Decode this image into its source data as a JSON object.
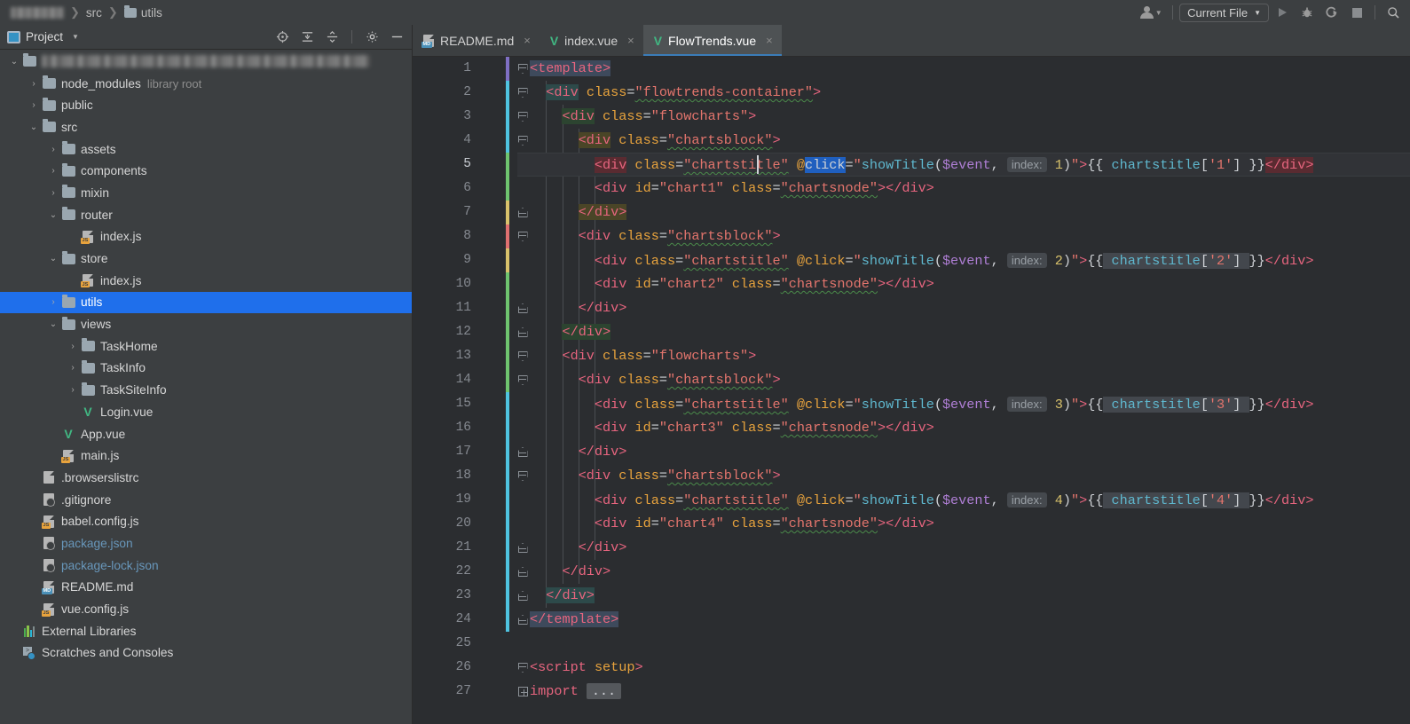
{
  "window": {
    "breadcrumb": [
      {
        "label": "",
        "blurred": true,
        "icon": ""
      },
      {
        "label": "src",
        "blurred": false,
        "icon": ""
      },
      {
        "label": "utils",
        "blurred": false,
        "icon": "folder-icon"
      }
    ],
    "run_config_label": "Current File",
    "toolbar_icons": [
      "person-icon",
      "run-icon",
      "debug-icon",
      "run-coverage-icon",
      "stop-icon",
      "search-icon"
    ]
  },
  "sidebar": {
    "title": "Project",
    "header_icons": [
      "locate-icon",
      "expand-all-icon",
      "collapse-all-icon",
      "gear-icon",
      "hide-icon"
    ],
    "tree": [
      {
        "depth": 0,
        "label": "",
        "blurred": true,
        "arrow": "down",
        "icon": "folder-icon",
        "sub": "",
        "selected": false
      },
      {
        "depth": 1,
        "label": "node_modules",
        "arrow": "right",
        "icon": "folder-icon",
        "sub": "library root",
        "selected": false
      },
      {
        "depth": 1,
        "label": "public",
        "arrow": "right",
        "icon": "folder-icon",
        "sub": "",
        "selected": false
      },
      {
        "depth": 1,
        "label": "src",
        "arrow": "down",
        "icon": "folder-icon",
        "sub": "",
        "selected": false
      },
      {
        "depth": 2,
        "label": "assets",
        "arrow": "right",
        "icon": "folder-icon",
        "sub": "",
        "selected": false
      },
      {
        "depth": 2,
        "label": "components",
        "arrow": "right",
        "icon": "folder-icon",
        "sub": "",
        "selected": false
      },
      {
        "depth": 2,
        "label": "mixin",
        "arrow": "right",
        "icon": "folder-icon",
        "sub": "",
        "selected": false
      },
      {
        "depth": 2,
        "label": "router",
        "arrow": "down",
        "icon": "folder-icon",
        "sub": "",
        "selected": false
      },
      {
        "depth": 3,
        "label": "index.js",
        "arrow": "none",
        "icon": "js-file-icon",
        "sub": "",
        "selected": false
      },
      {
        "depth": 2,
        "label": "store",
        "arrow": "down",
        "icon": "folder-icon",
        "sub": "",
        "selected": false
      },
      {
        "depth": 3,
        "label": "index.js",
        "arrow": "none",
        "icon": "js-file-icon",
        "sub": "",
        "selected": false
      },
      {
        "depth": 2,
        "label": "utils",
        "arrow": "right",
        "icon": "folder-icon",
        "sub": "",
        "selected": true
      },
      {
        "depth": 2,
        "label": "views",
        "arrow": "down",
        "icon": "folder-icon",
        "sub": "",
        "selected": false
      },
      {
        "depth": 3,
        "label": "TaskHome",
        "arrow": "right",
        "icon": "folder-icon",
        "sub": "",
        "selected": false
      },
      {
        "depth": 3,
        "label": "TaskInfo",
        "arrow": "right",
        "icon": "folder-icon",
        "sub": "",
        "selected": false
      },
      {
        "depth": 3,
        "label": "TaskSiteInfo",
        "arrow": "right",
        "icon": "folder-icon",
        "sub": "",
        "selected": false
      },
      {
        "depth": 3,
        "label": "Login.vue",
        "arrow": "none",
        "icon": "vue-file-icon",
        "sub": "",
        "selected": false
      },
      {
        "depth": 2,
        "label": "App.vue",
        "arrow": "none",
        "icon": "vue-file-icon",
        "sub": "",
        "selected": false
      },
      {
        "depth": 2,
        "label": "main.js",
        "arrow": "none",
        "icon": "js-file-icon",
        "sub": "",
        "selected": false
      },
      {
        "depth": 1,
        "label": ".browserslistrc",
        "arrow": "none",
        "icon": "text-file-icon",
        "sub": "",
        "selected": false
      },
      {
        "depth": 1,
        "label": ".gitignore",
        "arrow": "none",
        "icon": "gitignore-file-icon",
        "sub": "",
        "selected": false
      },
      {
        "depth": 1,
        "label": "babel.config.js",
        "arrow": "none",
        "icon": "js-file-icon",
        "sub": "",
        "selected": false
      },
      {
        "depth": 1,
        "label": "package.json",
        "arrow": "none",
        "icon": "json-file-icon",
        "sub": "",
        "selected": false,
        "blue": true
      },
      {
        "depth": 1,
        "label": "package-lock.json",
        "arrow": "none",
        "icon": "json-file-icon",
        "sub": "",
        "selected": false,
        "blue": true
      },
      {
        "depth": 1,
        "label": "README.md",
        "arrow": "none",
        "icon": "md-file-icon",
        "sub": "",
        "selected": false
      },
      {
        "depth": 1,
        "label": "vue.config.js",
        "arrow": "none",
        "icon": "js-file-icon",
        "sub": "",
        "selected": false
      },
      {
        "depth": 0,
        "label": "External Libraries",
        "arrow": "none",
        "icon": "libraries-icon",
        "sub": "",
        "selected": false
      },
      {
        "depth": 0,
        "label": "Scratches and Consoles",
        "arrow": "none",
        "icon": "scratches-icon",
        "sub": "",
        "selected": false
      }
    ]
  },
  "editor": {
    "tabs": [
      {
        "label": "README.md",
        "icon": "md-file-icon",
        "active": false
      },
      {
        "label": "index.vue",
        "icon": "vue-file-icon",
        "active": false
      },
      {
        "label": "FlowTrends.vue",
        "icon": "vue-file-icon",
        "active": true
      }
    ],
    "close_glyph": "×",
    "current_line": 5,
    "line_numbers": [
      1,
      2,
      3,
      4,
      5,
      6,
      7,
      8,
      9,
      10,
      11,
      12,
      13,
      14,
      15,
      16,
      17,
      18,
      19,
      20,
      21,
      22,
      23,
      24,
      25,
      26,
      27
    ],
    "code_text": [
      "<template>",
      "  <div class=\"flowtrends-container\">",
      "    <div class=\"flowcharts\">",
      "      <div class=\"chartsblock\">",
      "        <div class=\"chartstitle\" @click=\"showTitle($event, index: 1)\">{{ chartstitle['1'] }}</div>",
      "        <div id=\"chart1\" class=\"chartsnode\"></div>",
      "      </div>",
      "      <div class=\"chartsblock\">",
      "        <div class=\"chartstitle\" @click=\"showTitle($event, index: 2)\">{{ chartstitle['2'] }}</div>",
      "        <div id=\"chart2\" class=\"chartsnode\"></div>",
      "      </div>",
      "    </div>",
      "    <div class=\"flowcharts\">",
      "      <div class=\"chartsblock\">",
      "        <div class=\"chartstitle\" @click=\"showTitle($event, index: 3)\">{{ chartstitle['3'] }}</div>",
      "        <div id=\"chart3\" class=\"chartsnode\"></div>",
      "      </div>",
      "      <div class=\"chartsblock\">",
      "        <div class=\"chartstitle\" @click=\"showTitle($event, index: 4)\">{{ chartstitle['4'] }}</div>",
      "        <div id=\"chart4\" class=\"chartsnode\"></div>",
      "      </div>",
      "    </div>",
      "  </div>",
      "</template>",
      "",
      "<script setup>",
      "import ..."
    ],
    "param_hint_label": "index:",
    "fold_placeholder": "..."
  },
  "colors": {
    "accent_blue": "#1f6feb",
    "tab_underline": "#3b7cb8",
    "vue_green": "#41b883",
    "editor_bg": "#2b2d30",
    "panel_bg": "#3c3f41",
    "tag_pink": "#e8657f",
    "attr_orange": "#e8a33d",
    "string_red": "#e4756d",
    "func_cyan": "#5fb8cf",
    "var_purple": "#b07fd6",
    "num_yellow": "#d9c26b"
  }
}
